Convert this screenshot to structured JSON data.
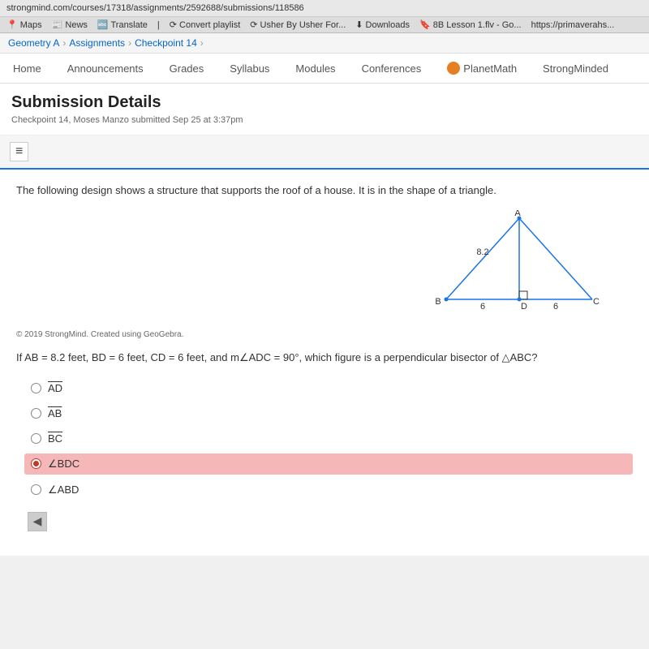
{
  "browser": {
    "url": "strongmind.com/courses/17318/assignments/2592688/submissions/118586",
    "toolbar_items": [
      "Maps",
      "News",
      "Translate",
      "Convert playlist",
      "Usher By Usher For...",
      "Downloads",
      "8B Lesson 1.flv - Go...",
      "https://primaverahs..."
    ]
  },
  "breadcrumb": {
    "items": [
      "Geometry A",
      "Assignments",
      "Checkpoint 14"
    ]
  },
  "nav": {
    "items": [
      "Home",
      "Announcements",
      "Grades",
      "Syllabus",
      "Modules",
      "Conferences",
      "PlanetMath",
      "StrongMinded"
    ]
  },
  "page": {
    "title": "Submission Details",
    "subtitle": "Checkpoint 14, Moses Manzo  submitted Sep 25 at 3:37pm"
  },
  "question": {
    "description": "The following design shows a structure that supports the roof of a house. It is in the shape of a triangle.",
    "copyright": "© 2019 StrongMind. Created using GeoGebra.",
    "math_question": "If AB = 8.2 feet, BD = 6 feet, CD = 6 feet, and m∠ADC = 90°, which figure is a perpendicular bisector of △ABC?",
    "diagram": {
      "label_A": "A",
      "label_B": "B",
      "label_C": "C",
      "label_D": "D",
      "measure_AB": "8.2",
      "measure_BD": "6",
      "measure_CD": "6"
    },
    "choices": [
      {
        "id": "choice-ad",
        "label": "AD",
        "type": "overline",
        "selected": false
      },
      {
        "id": "choice-ab",
        "label": "AB",
        "type": "overline",
        "selected": false
      },
      {
        "id": "choice-bc",
        "label": "BC",
        "type": "overline",
        "selected": false
      },
      {
        "id": "choice-bdc",
        "label": "∠BDC",
        "type": "angle",
        "selected": true
      },
      {
        "id": "choice-abd",
        "label": "∠ABD",
        "type": "angle",
        "selected": false
      }
    ]
  },
  "toolbar": {
    "hamburger_label": "≡"
  }
}
